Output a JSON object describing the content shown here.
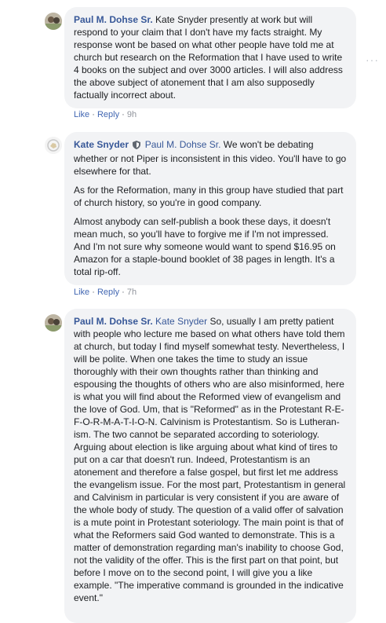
{
  "comments": [
    {
      "author": "Paul M. Dohse Sr.",
      "mention": "",
      "paragraphs": [
        "Kate Snyder presently at work but will respond to your claim that I don't have my facts straight. My response wont be based on what other people have told me at church but research on the Reformation that I have used to write 4 books on the subject and over 3000 articles. I will also address the above subject of atonement that I am also supposedly factually incorrect about."
      ],
      "actions": {
        "like": "Like",
        "reply": "Reply",
        "time": "9h"
      }
    },
    {
      "author": "Kate Snyder",
      "mention": "Paul M. Dohse Sr.",
      "paragraphs": [
        "We won't be debating whether or not Piper is inconsistent in this video. You'll have to go elsewhere for that.",
        "As for the Reformation, many in this group have studied that part of church history, so you're in good company.",
        "Almost anybody can self-publish a book these days, it doesn't mean much, so you'll have to forgive me if I'm not impressed. And I'm not sure why someone would want to spend $16.95 on Amazon for a staple-bound booklet of 38 pages in length. It's a total rip-off."
      ],
      "actions": {
        "like": "Like",
        "reply": "Reply",
        "time": "7h"
      }
    },
    {
      "author": "Paul M. Dohse Sr.",
      "mention": "Kate Snyder",
      "paragraphs": [
        "So, usually I am pretty patient with people who lecture me based on what others have told them at church, but today I find myself somewhat testy. Nevertheless, I will be polite. When one takes the time to study an issue thoroughly with their own thoughts rather than thinking and espousing the thoughts of others who are also misinformed, here is what you will find about the Reformed view of evangelism and the love of God. Um, that is \"Reformed\" as in the Protestant R-E-F-O-R-M-A-T-I-O-N. Calvinism is Protestantism. So is Lutheran-ism. The two cannot be separated according to soteriology. Arguing about election is like arguing about what kind of tires to put on a car that doesn't run. Indeed, Protestantism is an atonement and therefore a false gospel, but first let me address the evangelism issue. For the most part, Protestantism in general and Calvinism in particular is very consistent if you are aware of the whole body of study. The question of a valid offer of salvation is a mute point in Protestant soteriology. The main point is that of what the Reformers said God wanted to demonstrate. This is a matter of demonstration regarding man's inability to choose God, not the validity of the offer. This is the first part on that point, but before I move on to the second point, I will give you a like example. \"The imperative command is grounded in the indicative event.\""
      ]
    }
  ],
  "separator": "·",
  "colors": {
    "link": "#385898",
    "bubble": "#f2f3f5",
    "meta": "#90949c"
  },
  "icons": {
    "more": "more-options-icon",
    "moderator": "shield-icon"
  }
}
